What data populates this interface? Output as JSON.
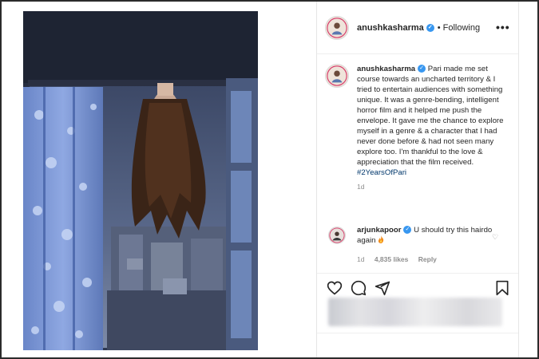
{
  "post": {
    "username": "anushkasharma",
    "verified_mark": "✓",
    "separator": "•",
    "follow_status": "Following",
    "more_icon": "more-horizontal-icon",
    "more_glyph": "•••",
    "caption": {
      "username": "anushkasharma",
      "text": "Pari made me set course towards an uncharted territory & I tried to entertain audiences with something unique. It was a genre-bending, intelligent horror film and it helped me push the envelope. It gave me the chance to explore myself in a genre & a character that I had never done before & had not seen many explore too. I'm thankful to the love & appreciation that the film received.",
      "hashtag": "#2YearsOfPari",
      "time": "1d"
    },
    "comment": {
      "username": "arjunkapoor",
      "text": "U should try this hairdo again",
      "emoji_icon": "fire-icon",
      "time": "1d",
      "likes": "4,835 likes",
      "reply": "Reply",
      "heart_icon": "heart-outline-icon",
      "heart_glyph": "♡"
    },
    "actions": {
      "like_icon": "heart-icon",
      "comment_icon": "comment-icon",
      "share_icon": "send-icon",
      "save_icon": "bookmark-icon"
    }
  },
  "colors": {
    "verified": "#3897f0",
    "hashtag": "#00376b",
    "muted": "#8e8e8e",
    "text": "#262626"
  }
}
